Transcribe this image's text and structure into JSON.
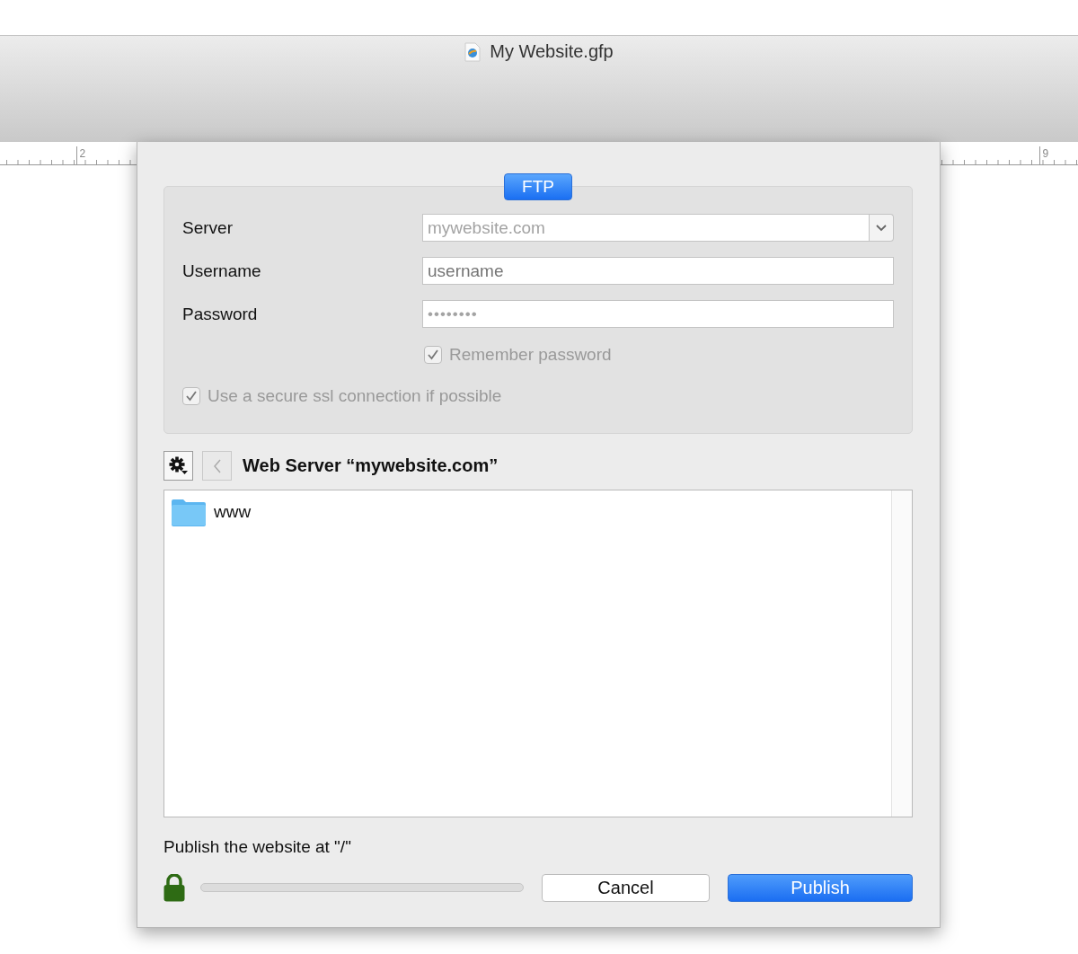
{
  "window": {
    "title": "My Website.gfp"
  },
  "rulers": {
    "left_label": "2",
    "right_label": "9"
  },
  "sheet": {
    "tab": {
      "label": "FTP",
      "selected": true
    },
    "fields": [
      {
        "kind": "combo",
        "label": "Server",
        "value": "mywebsite.com",
        "disabled": true
      },
      {
        "kind": "text",
        "label": "Username",
        "placeholder": "username",
        "disabled": true
      },
      {
        "kind": "secret",
        "label": "Password",
        "value": "••••••••",
        "disabled": true
      }
    ],
    "checkboxes": [
      {
        "label": "Remember password",
        "checked": true,
        "disabled": true,
        "indented": true
      },
      {
        "label": "Use a secure ssl connection if possible",
        "checked": true,
        "disabled": true,
        "indented": false
      }
    ],
    "browser": {
      "title": "Web Server “mywebsite.com”",
      "back_disabled": true,
      "items": [
        {
          "kind": "folder",
          "name": "www"
        }
      ]
    },
    "status": "Publish the website at \"/\"",
    "progress": {
      "level": 0
    },
    "buttons": [
      {
        "label": "Cancel",
        "default": false
      },
      {
        "label": "Publish",
        "default": true
      }
    ]
  }
}
